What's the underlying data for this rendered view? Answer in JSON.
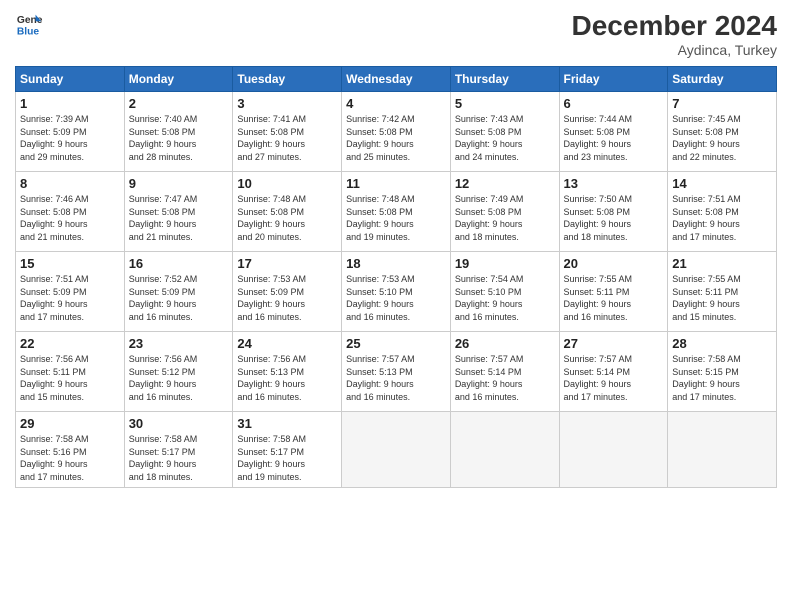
{
  "header": {
    "logo_line1": "General",
    "logo_line2": "Blue",
    "month": "December 2024",
    "location": "Aydinca, Turkey"
  },
  "weekdays": [
    "Sunday",
    "Monday",
    "Tuesday",
    "Wednesday",
    "Thursday",
    "Friday",
    "Saturday"
  ],
  "weeks": [
    [
      {
        "day": "1",
        "sunrise": "7:39 AM",
        "sunset": "5:09 PM",
        "daylight": "9 hours and 29 minutes."
      },
      {
        "day": "2",
        "sunrise": "7:40 AM",
        "sunset": "5:08 PM",
        "daylight": "9 hours and 28 minutes."
      },
      {
        "day": "3",
        "sunrise": "7:41 AM",
        "sunset": "5:08 PM",
        "daylight": "9 hours and 27 minutes."
      },
      {
        "day": "4",
        "sunrise": "7:42 AM",
        "sunset": "5:08 PM",
        "daylight": "9 hours and 25 minutes."
      },
      {
        "day": "5",
        "sunrise": "7:43 AM",
        "sunset": "5:08 PM",
        "daylight": "9 hours and 24 minutes."
      },
      {
        "day": "6",
        "sunrise": "7:44 AM",
        "sunset": "5:08 PM",
        "daylight": "9 hours and 23 minutes."
      },
      {
        "day": "7",
        "sunrise": "7:45 AM",
        "sunset": "5:08 PM",
        "daylight": "9 hours and 22 minutes."
      }
    ],
    [
      {
        "day": "8",
        "sunrise": "7:46 AM",
        "sunset": "5:08 PM",
        "daylight": "9 hours and 21 minutes."
      },
      {
        "day": "9",
        "sunrise": "7:47 AM",
        "sunset": "5:08 PM",
        "daylight": "9 hours and 21 minutes."
      },
      {
        "day": "10",
        "sunrise": "7:48 AM",
        "sunset": "5:08 PM",
        "daylight": "9 hours and 20 minutes."
      },
      {
        "day": "11",
        "sunrise": "7:48 AM",
        "sunset": "5:08 PM",
        "daylight": "9 hours and 19 minutes."
      },
      {
        "day": "12",
        "sunrise": "7:49 AM",
        "sunset": "5:08 PM",
        "daylight": "9 hours and 18 minutes."
      },
      {
        "day": "13",
        "sunrise": "7:50 AM",
        "sunset": "5:08 PM",
        "daylight": "9 hours and 18 minutes."
      },
      {
        "day": "14",
        "sunrise": "7:51 AM",
        "sunset": "5:08 PM",
        "daylight": "9 hours and 17 minutes."
      }
    ],
    [
      {
        "day": "15",
        "sunrise": "7:51 AM",
        "sunset": "5:09 PM",
        "daylight": "9 hours and 17 minutes."
      },
      {
        "day": "16",
        "sunrise": "7:52 AM",
        "sunset": "5:09 PM",
        "daylight": "9 hours and 16 minutes."
      },
      {
        "day": "17",
        "sunrise": "7:53 AM",
        "sunset": "5:09 PM",
        "daylight": "9 hours and 16 minutes."
      },
      {
        "day": "18",
        "sunrise": "7:53 AM",
        "sunset": "5:10 PM",
        "daylight": "9 hours and 16 minutes."
      },
      {
        "day": "19",
        "sunrise": "7:54 AM",
        "sunset": "5:10 PM",
        "daylight": "9 hours and 16 minutes."
      },
      {
        "day": "20",
        "sunrise": "7:55 AM",
        "sunset": "5:11 PM",
        "daylight": "9 hours and 16 minutes."
      },
      {
        "day": "21",
        "sunrise": "7:55 AM",
        "sunset": "5:11 PM",
        "daylight": "9 hours and 15 minutes."
      }
    ],
    [
      {
        "day": "22",
        "sunrise": "7:56 AM",
        "sunset": "5:11 PM",
        "daylight": "9 hours and 15 minutes."
      },
      {
        "day": "23",
        "sunrise": "7:56 AM",
        "sunset": "5:12 PM",
        "daylight": "9 hours and 16 minutes."
      },
      {
        "day": "24",
        "sunrise": "7:56 AM",
        "sunset": "5:13 PM",
        "daylight": "9 hours and 16 minutes."
      },
      {
        "day": "25",
        "sunrise": "7:57 AM",
        "sunset": "5:13 PM",
        "daylight": "9 hours and 16 minutes."
      },
      {
        "day": "26",
        "sunrise": "7:57 AM",
        "sunset": "5:14 PM",
        "daylight": "9 hours and 16 minutes."
      },
      {
        "day": "27",
        "sunrise": "7:57 AM",
        "sunset": "5:14 PM",
        "daylight": "9 hours and 17 minutes."
      },
      {
        "day": "28",
        "sunrise": "7:58 AM",
        "sunset": "5:15 PM",
        "daylight": "9 hours and 17 minutes."
      }
    ],
    [
      {
        "day": "29",
        "sunrise": "7:58 AM",
        "sunset": "5:16 PM",
        "daylight": "9 hours and 17 minutes."
      },
      {
        "day": "30",
        "sunrise": "7:58 AM",
        "sunset": "5:17 PM",
        "daylight": "9 hours and 18 minutes."
      },
      {
        "day": "31",
        "sunrise": "7:58 AM",
        "sunset": "5:17 PM",
        "daylight": "9 hours and 19 minutes."
      },
      null,
      null,
      null,
      null
    ]
  ]
}
